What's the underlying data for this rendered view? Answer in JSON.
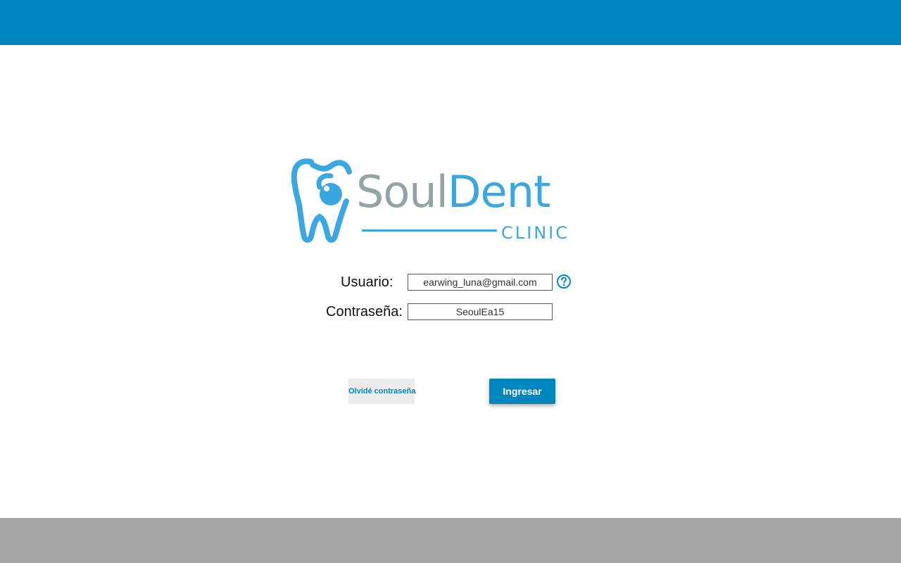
{
  "logo": {
    "word_part1": "Soul",
    "word_part2": "Dent",
    "subtitle": "CLINIC",
    "icon": "tooth-icon"
  },
  "form": {
    "user_label": "Usuario:",
    "user_value": "earwing_luna@gmail.com",
    "password_label": "Contraseña:",
    "password_value": "SeoulEa15",
    "help_icon": "question-circle-icon"
  },
  "actions": {
    "forgot_label": "Olvidé contraseña",
    "login_label": "Ingresar"
  },
  "colors": {
    "primary": "#0086be",
    "footer": "#a6a6a6",
    "logo_blue": "#3ba7e0",
    "logo_gray": "#93a3a8",
    "secondary_button_bg": "#ececec"
  }
}
